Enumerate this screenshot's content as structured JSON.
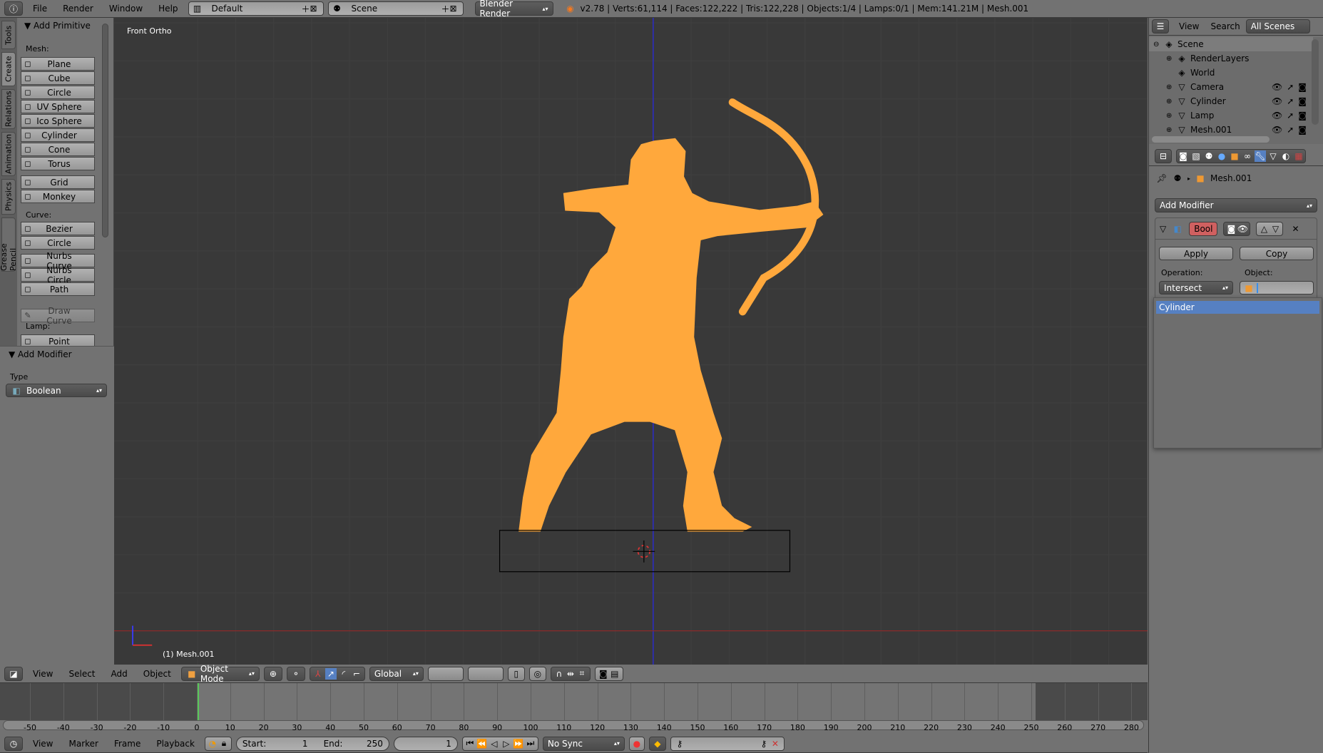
{
  "top_bar": {
    "menus": [
      "File",
      "Render",
      "Window",
      "Help"
    ],
    "layout": "Default",
    "scene": "Scene",
    "engine": "Blender Render",
    "stats": "v2.78 | Verts:61,114 | Faces:122,222 | Tris:122,228 | Objects:1/4 | Lamps:0/1 | Mem:141.21M | Mesh.001"
  },
  "toolshelf": {
    "tabs": [
      "Tools",
      "Create",
      "Relations",
      "Animation",
      "Physics",
      "Grease Pencil"
    ],
    "active_tab": "Create",
    "panel_title": "Add Primitive",
    "mesh_label": "Mesh:",
    "mesh": [
      {
        "label": "Plane",
        "icon": "plane-icon"
      },
      {
        "label": "Cube",
        "icon": "cube-icon"
      },
      {
        "label": "Circle",
        "icon": "circle-icon"
      },
      {
        "label": "UV Sphere",
        "icon": "uv-sphere-icon"
      },
      {
        "label": "Ico Sphere",
        "icon": "ico-sphere-icon"
      },
      {
        "label": "Cylinder",
        "icon": "cylinder-icon"
      },
      {
        "label": "Cone",
        "icon": "cone-icon"
      },
      {
        "label": "Torus",
        "icon": "torus-icon"
      }
    ],
    "mesh2": [
      {
        "label": "Grid",
        "icon": "grid-icon"
      },
      {
        "label": "Monkey",
        "icon": "monkey-icon"
      }
    ],
    "curve_label": "Curve:",
    "curve": [
      {
        "label": "Bezier",
        "icon": "bezier-icon"
      },
      {
        "label": "Circle",
        "icon": "curve-circle-icon"
      }
    ],
    "curve2": [
      {
        "label": "Nurbs Curve",
        "icon": "nurbs-curve-icon"
      },
      {
        "label": "Nurbs Circle",
        "icon": "nurbs-circle-icon"
      },
      {
        "label": "Path",
        "icon": "path-icon"
      }
    ],
    "draw_curve": "Draw Curve",
    "lamp_label": "Lamp:",
    "lamp": [
      {
        "label": "Point",
        "icon": "point-lamp-icon"
      }
    ],
    "operator_title": "Add Modifier",
    "type_label": "Type",
    "type_value": "Boolean"
  },
  "viewport": {
    "view_name": "Front Ortho",
    "object_label": "(1) Mesh.001",
    "mesh_color": "#ffa83c"
  },
  "view3d_header": {
    "menus": [
      "View",
      "Select",
      "Add",
      "Object"
    ],
    "mode": "Object Mode",
    "orientation": "Global"
  },
  "timeline": {
    "ticks": [
      -50,
      -40,
      -30,
      -20,
      -10,
      0,
      10,
      20,
      30,
      40,
      50,
      60,
      70,
      80,
      90,
      100,
      110,
      120,
      130,
      140,
      150,
      160,
      170,
      180,
      190,
      200,
      210,
      220,
      230,
      240,
      250,
      260,
      270,
      280
    ],
    "current_frame": 1,
    "start": 1,
    "end": 250,
    "menus": [
      "View",
      "Marker",
      "Frame",
      "Playback"
    ],
    "start_label": "Start:",
    "end_label": "End:",
    "sync": "No Sync"
  },
  "outliner": {
    "menus": [
      "View",
      "Search"
    ],
    "filter": "All Scenes",
    "items": [
      {
        "label": "Scene",
        "icon": "scene-icon"
      },
      {
        "label": "RenderLayers",
        "icon": "render-layers-icon"
      },
      {
        "label": "World",
        "icon": "world-icon"
      },
      {
        "label": "Camera",
        "icon": "camera-icon"
      },
      {
        "label": "Cylinder",
        "icon": "mesh-icon"
      },
      {
        "label": "Lamp",
        "icon": "lamp-icon"
      },
      {
        "label": "Mesh.001",
        "icon": "mesh-icon"
      }
    ]
  },
  "properties": {
    "breadcrumb": "Mesh.001",
    "add_modifier": "Add Modifier",
    "modifier_name": "Bool",
    "apply": "Apply",
    "copy": "Copy",
    "operation_label": "Operation:",
    "operation": "Intersect",
    "object_label": "Object:",
    "object_value": "",
    "dropdown_items": [
      "Cylinder"
    ]
  }
}
